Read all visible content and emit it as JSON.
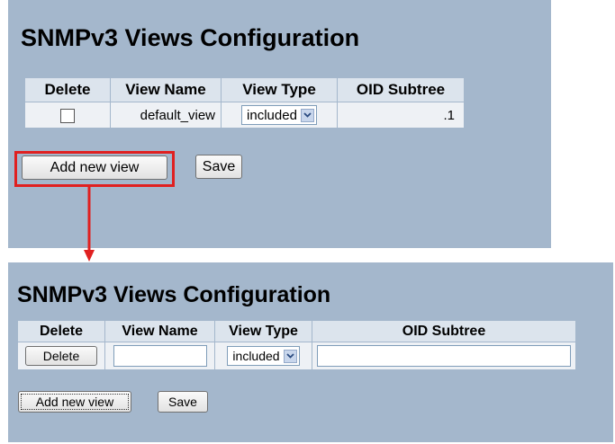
{
  "top": {
    "title": "SNMPv3 Views Configuration",
    "headers": [
      "Delete",
      "View Name",
      "View Type",
      "OID Subtree"
    ],
    "row": {
      "delete_checked": false,
      "view_name": "default_view",
      "view_type": "included",
      "oid_subtree": ".1"
    },
    "add_button": "Add new view",
    "save_button": "Save"
  },
  "bottom": {
    "title": "SNMPv3 Views Configuration",
    "headers": [
      "Delete",
      "View Name",
      "View Type",
      "OID Subtree"
    ],
    "row": {
      "delete_button": "Delete",
      "view_name": "",
      "view_type": "included",
      "oid_subtree": ""
    },
    "add_button": "Add new view",
    "save_button": "Save"
  },
  "colors": {
    "panel_bg": "#a4b7cc",
    "header_bg": "#dce4ed",
    "cell_bg": "#eef1f5",
    "highlight": "#e02020"
  },
  "icons": {
    "select_arrow": "chevron-down-icon"
  }
}
